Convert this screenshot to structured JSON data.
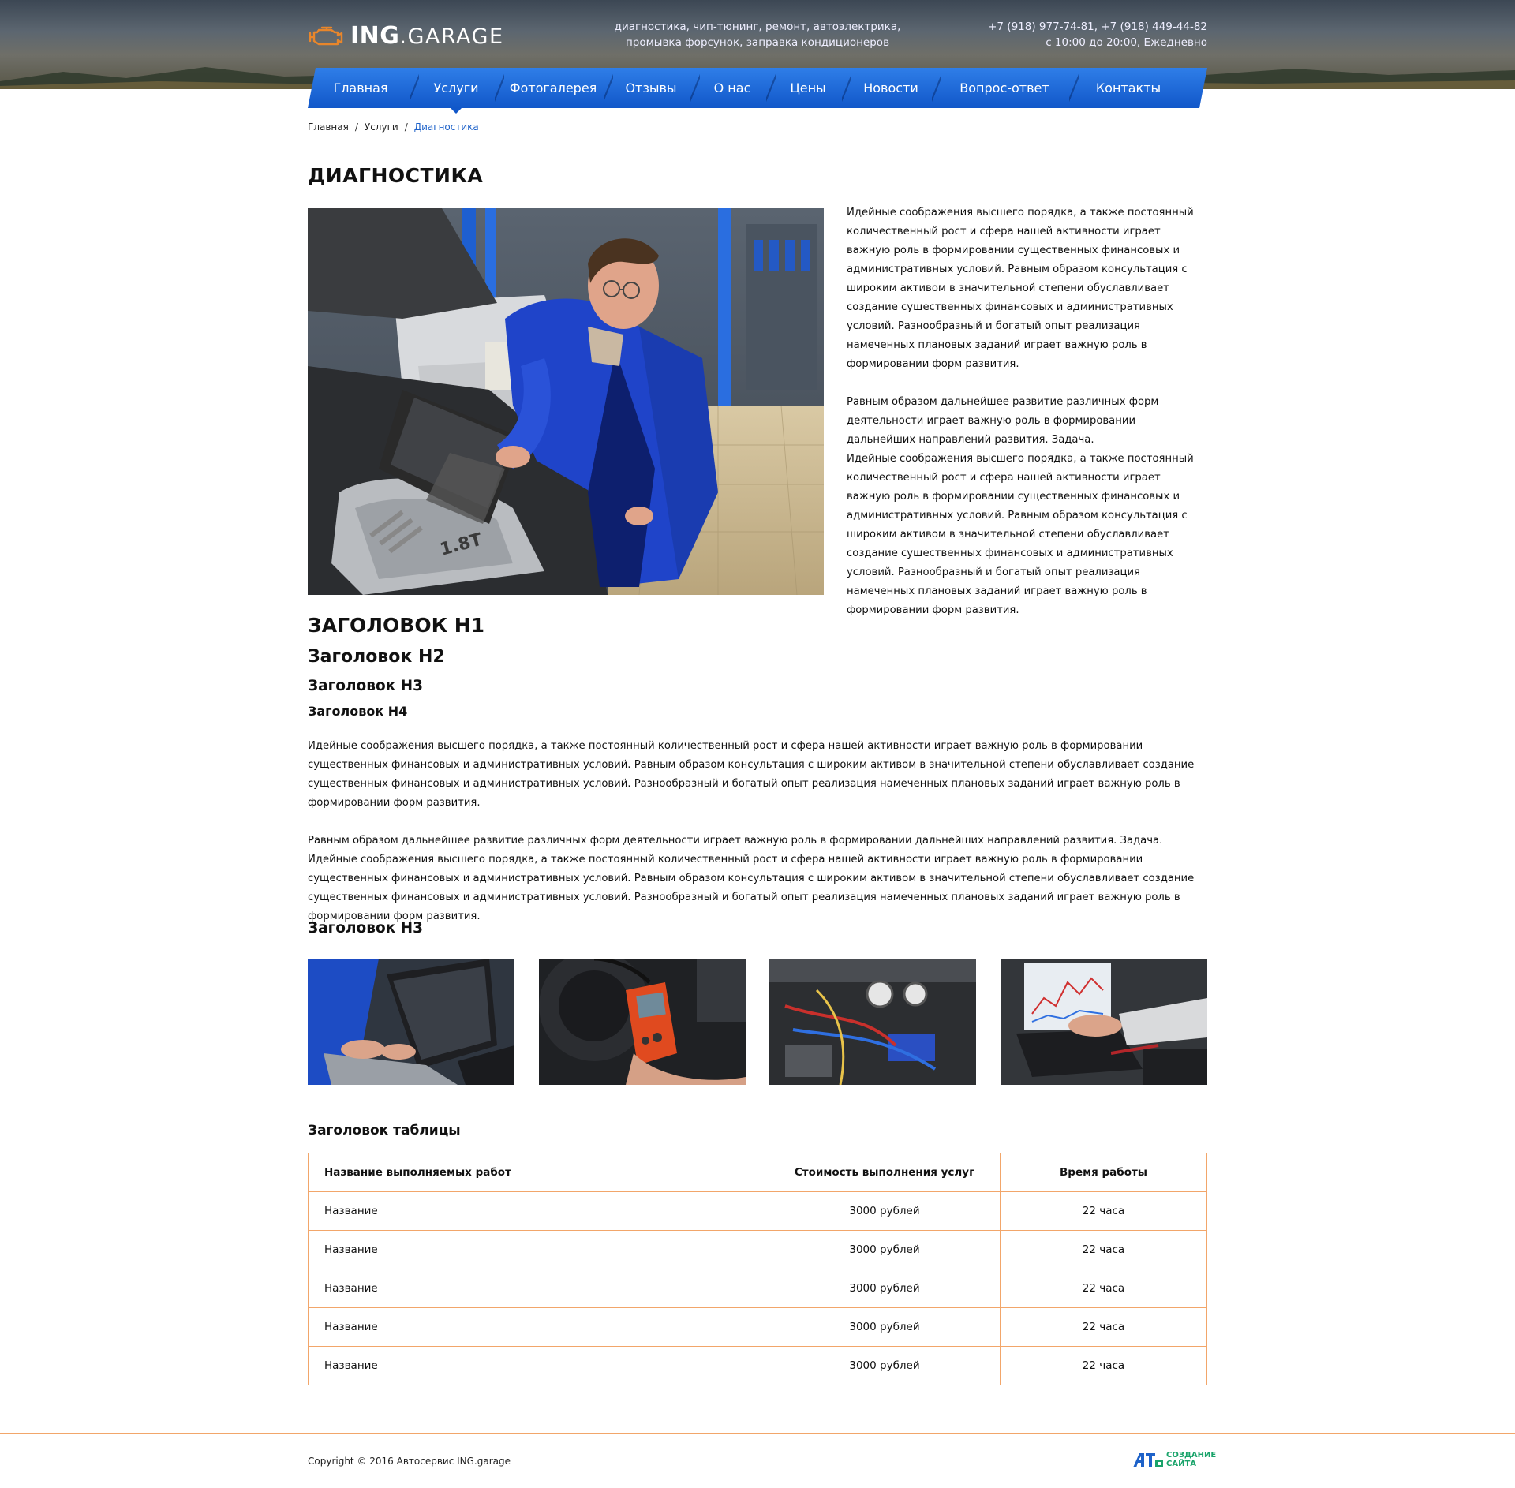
{
  "header": {
    "brand_main": "ING",
    "brand_dot": ".",
    "brand_sub": "GARAGE",
    "tagline_line1": "диагностика, чип-тюнинг, ремонт, автоэлектрика,",
    "tagline_line2": "промывка форсунок, заправка кондиционеров",
    "phones": "+7 (918) 977-74-81,  +7 (918) 449-44-82",
    "hours": "с 10:00 до 20:00, Ежедневно"
  },
  "nav": {
    "items": [
      {
        "label": "Главная"
      },
      {
        "label": "Услуги"
      },
      {
        "label": "Фотогалерея"
      },
      {
        "label": "Отзывы"
      },
      {
        "label": "О нас"
      },
      {
        "label": "Цены"
      },
      {
        "label": "Новости"
      },
      {
        "label": "Вопрос-ответ"
      },
      {
        "label": "Контакты"
      }
    ],
    "active": "Услуги"
  },
  "breadcrumb": {
    "home": "Главная",
    "services": "Услуги",
    "current": "Диагностика",
    "separator": "/"
  },
  "page": {
    "title": "ДИАГНОСТИКА",
    "side_p1": "Идейные соображения высшего порядка, а также постоянный количественный рост и сфера нашей активности играет важную роль в формировании существенных финансовых и административных условий. Равным образом консультация с широким активом в значительной степени обуславливает создание существенных финансовых и административных условий. Разнообразный и богатый опыт реализация намеченных плановых заданий играет важную роль в формировании форм развития.",
    "side_p2": "Равным образом дальнейшее развитие различных форм деятельности играет важную роль в формировании дальнейших направлений развития. Задача.",
    "side_p3": "Идейные соображения высшего порядка, а также постоянный количественный рост и сфера нашей активности играет важную роль в формировании существенных финансовых и административных условий. Равным образом консультация с широким активом в значительной степени обуславливает создание существенных финансовых и административных условий. Разнообразный и богатый опыт реализация намеченных плановых заданий играет важную роль в формировании форм развития.",
    "h1": "ЗАГОЛОВОК H1",
    "h2": "Заголовок H2",
    "h3": "Заголовок H3",
    "h4": "Заголовок H4",
    "body_p1": "Идейные соображения высшего порядка, а также постоянный количественный рост и сфера нашей активности играет важную роль в формировании существенных финансовых и административных условий. Равным образом консультация с широким активом в значительной степени обуславливает создание существенных финансовых и административных условий. Разнообразный и богатый опыт реализация намеченных плановых заданий играет важную роль в формировании форм развития.",
    "body_p2": "Равным образом дальнейшее развитие различных форм деятельности играет важную роль в формировании дальнейших направлений развития. Задача.",
    "body_p3": "Идейные соображения высшего порядка, а также постоянный количественный рост и сфера нашей активности играет важную роль в формировании существенных финансовых и административных условий. Равным образом консультация с широким активом в значительной степени обуславливает создание существенных финансовых и административных условий. Разнообразный и богатый опыт реализация намеченных плановых заданий играет важную роль в формировании форм развития.",
    "gallery_title": "Заголовок H3",
    "table_title": "Заголовок таблицы"
  },
  "table": {
    "headers": [
      "Название выполняемых работ",
      "Стоимость выполнения услуг",
      "Время работы"
    ],
    "rows": [
      [
        "Название",
        "3000 рублей",
        "22 часа"
      ],
      [
        "Название",
        "3000 рублей",
        "22 часа"
      ],
      [
        "Название",
        "3000 рублей",
        "22 часа"
      ],
      [
        "Название",
        "3000 рублей",
        "22 часа"
      ],
      [
        "Название",
        "3000 рублей",
        "22 часа"
      ]
    ]
  },
  "footer": {
    "copyright": "Copyright © 2016 Автосервис ING.garage",
    "studio_line1": "СОЗДАНИЕ",
    "studio_line2": "САЙТА"
  },
  "colors": {
    "nav_blue": "#1157c9",
    "link_blue": "#1e62c9",
    "table_border": "#f2a66a",
    "logo_orange": "#e8862b"
  }
}
